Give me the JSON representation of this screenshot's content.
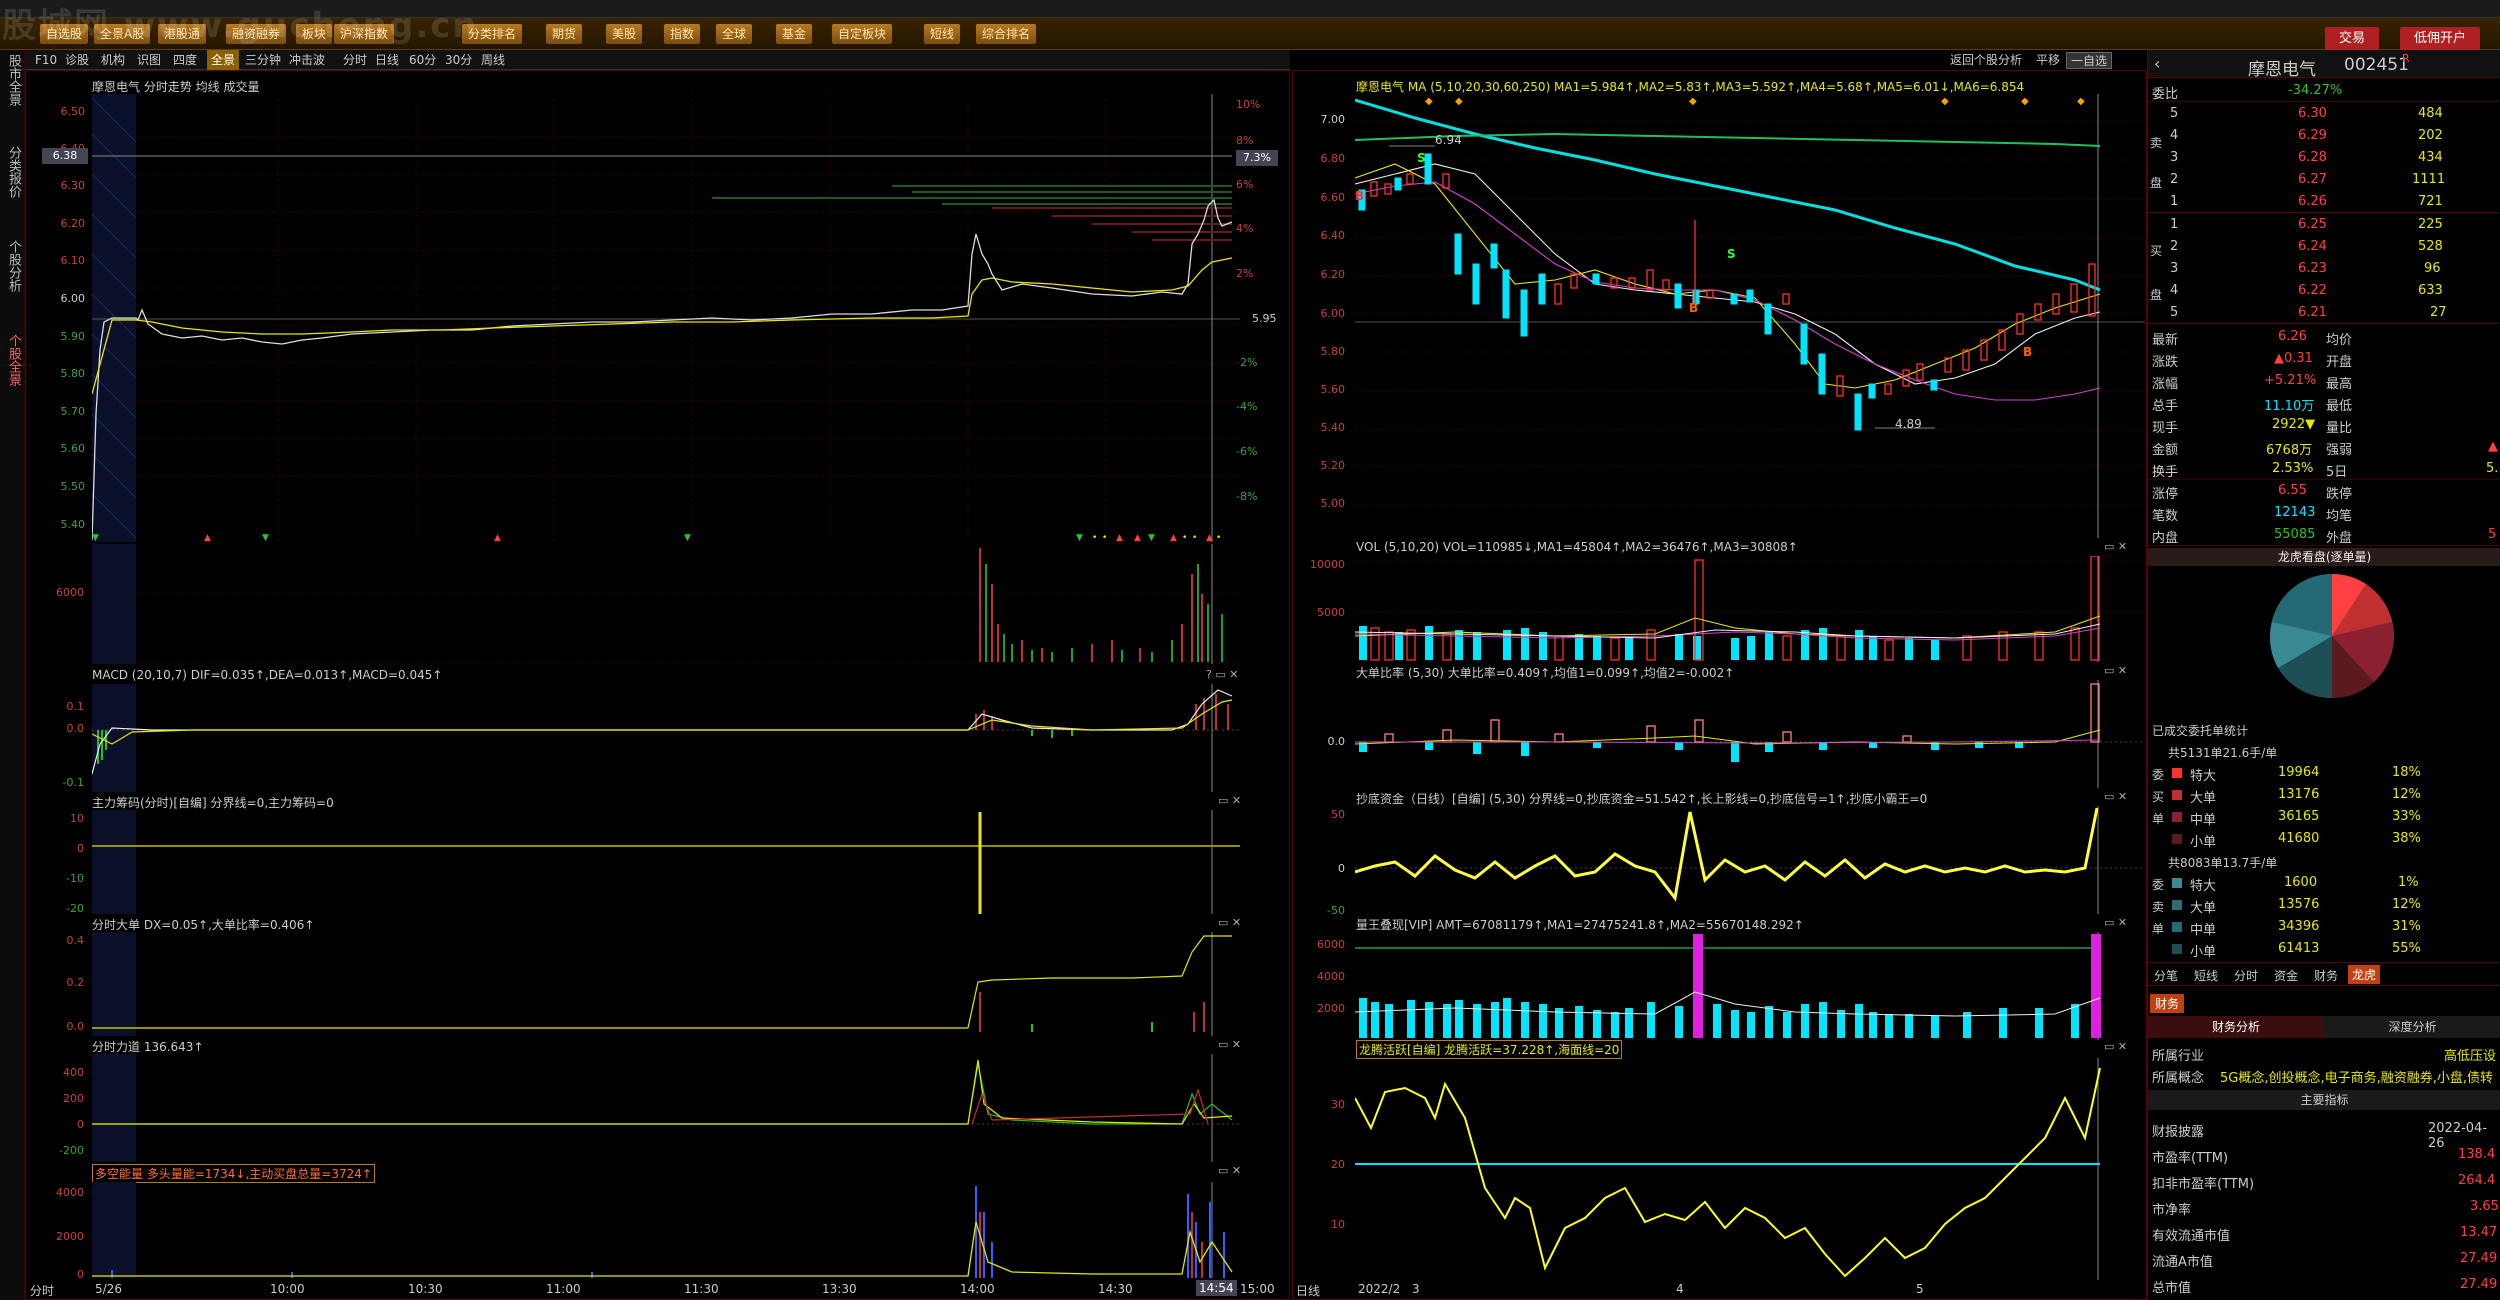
{
  "watermark": "股城网 www.gucheng.cn",
  "menu": [
    "自选股",
    "全景A股",
    "港股通",
    "融资融券",
    "板块",
    "沪深指数",
    "分类排名",
    "期货",
    "美股",
    "指数",
    "全球",
    "基金",
    "自定板块",
    "短线",
    "综合排名"
  ],
  "account_buttons": [
    "交易",
    "低佣开户"
  ],
  "left_tabs": [
    "股市全景",
    "分类报价",
    "个股分析",
    "个股全景"
  ],
  "intraday": {
    "toolbar": [
      "F10",
      "诊股",
      "机构",
      "识图",
      "四度",
      "全景",
      "三分钟",
      "冲击波",
      "分时",
      "日线",
      "60分",
      "30分",
      "周线"
    ],
    "title": "摩恩电气 分时走势 均线 成交量",
    "price_axis": [
      "6.50",
      "6.40",
      "6.30",
      "6.20",
      "6.10",
      "6.00",
      "5.90",
      "5.80",
      "5.70",
      "5.60",
      "5.50",
      "5.40"
    ],
    "pct_axis": [
      "10%",
      "8%",
      "7.3%",
      "6%",
      "4%",
      "2%",
      "5.95",
      "-2%",
      "-4%",
      "-6%",
      "-8%"
    ],
    "current_price_tag": "6.38",
    "vol_axis": "6000",
    "macd_title": "MACD (20,10,7) DIF=0.035↑,DEA=0.013↑,MACD=0.045↑",
    "macd_axis": [
      "0.1",
      "0.0",
      "-0.1"
    ],
    "main_title": "主力筹码(分时)[自编] 分界线=0,主力筹码=0",
    "main_axis": [
      "10",
      "0",
      "-10",
      "-20"
    ],
    "dadan_title": "分时大单 DX=0.05↑,大单比率=0.406↑",
    "dadan_axis": [
      "0.4",
      "0.2",
      "0.0"
    ],
    "lidao_title": "分时力道 136.643↑",
    "lidao_axis": [
      "400",
      "200",
      "0",
      "-200"
    ],
    "duokong_title": "多空能量 多头量能=1734↓,主动买盘总量=3724↑",
    "duokong_axis": [
      "4000",
      "2000",
      "0"
    ],
    "time_axis": [
      "分时",
      "5/26",
      "10:00",
      "10:30",
      "11:00",
      "11:30",
      "13:30",
      "14:00",
      "14:30",
      "14:54",
      "15:00"
    ]
  },
  "kline": {
    "title": "摩恩电气  MA (5,10,20,30,60,250) MA1=5.984↑,MA2=5.83↑,MA3=5.592↑,MA4=5.68↑,MA5=6.01↓,MA6=6.854",
    "back_btn": "返回个股分析",
    "flat": "平移",
    "select": "一自选",
    "price_axis": [
      "7.00",
      "6.80",
      "6.60",
      "6.40",
      "6.20",
      "6.00",
      "5.80",
      "5.60",
      "5.40",
      "5.20",
      "5.00"
    ],
    "high_label": "6.94",
    "low_label": "4.89",
    "vol_title": "VOL (5,10,20) VOL=110985↓,MA1=45804↑,MA2=36476↑,MA3=30808↑",
    "vol_axis": [
      "10000",
      "5000"
    ],
    "ratio_title": "大单比率 (5,30) 大单比率=0.409↑,均值1=0.099↑,均值2=-0.002↑",
    "ratio_axis": [
      "0.0"
    ],
    "chaodi_title": "抄底资金（日线）[自编] (5,30) 分界线=0,抄底资金=51.542↑,长上影线=0,抄底信号=1↑,抄底小霸王=0",
    "chaodi_axis": [
      "50",
      "0",
      "-50"
    ],
    "liang_title": "量王叠现[VIP] AMT=67081179↑,MA1=27475241.8↑,MA2=55670148.292↑",
    "liang_axis": [
      "6000",
      "4000",
      "2000"
    ],
    "longteng_title": "龙腾活跃[自编] 龙腾活跃=37.228↑,海面线=20",
    "longteng_axis": [
      "30",
      "20",
      "10"
    ],
    "date_axis": [
      "日线",
      "2022/2",
      "3",
      "4",
      "5"
    ]
  },
  "quote": {
    "name": "摩恩电气",
    "code": "002451",
    "flag": "R",
    "webi_label": "委比",
    "webi": "-34.27%",
    "sell": [
      [
        "5",
        "6.30",
        "484"
      ],
      [
        "4",
        "6.29",
        "202"
      ],
      [
        "3",
        "6.28",
        "434"
      ],
      [
        "2",
        "6.27",
        "1111"
      ],
      [
        "1",
        "6.26",
        "721"
      ]
    ],
    "buy": [
      [
        "1",
        "6.25",
        "225"
      ],
      [
        "2",
        "6.24",
        "528"
      ],
      [
        "3",
        "6.23",
        "96"
      ],
      [
        "4",
        "6.22",
        "633"
      ],
      [
        "5",
        "6.21",
        "27"
      ]
    ],
    "side_sell": [
      "卖",
      "盘"
    ],
    "side_buy": [
      "买",
      "盘"
    ],
    "stats": [
      [
        "最新",
        "6.26",
        "均价",
        ""
      ],
      [
        "涨跌",
        "▲0.31",
        "开盘",
        ""
      ],
      [
        "涨幅",
        "+5.21%",
        "最高",
        ""
      ],
      [
        "总手",
        "11.10万",
        "最低",
        ""
      ],
      [
        "现手",
        "2922▼",
        "量比",
        ""
      ],
      [
        "金额",
        "6768万",
        "强弱",
        "▲"
      ],
      [
        "换手",
        "2.53%",
        "5日",
        "5."
      ],
      [
        "涨停",
        "6.55",
        "跌停",
        ""
      ],
      [
        "笔数",
        "12143",
        "均笔",
        ""
      ],
      [
        "内盘",
        "55085",
        "外盘",
        "5"
      ]
    ],
    "lh_title": "龙虎看盘(逐单量)",
    "wtjb_title": "已成交委托单统计",
    "buy_hdr": "共5131单21.6手/单",
    "buy_rows": [
      [
        "特大",
        "19964",
        "18%"
      ],
      [
        "大单",
        "13176",
        "12%"
      ],
      [
        "中单",
        "36165",
        "33%"
      ],
      [
        "小单",
        "41680",
        "38%"
      ]
    ],
    "sell_hdr": "共8083单13.7手/单",
    "sell_rows": [
      [
        "特大",
        "1600",
        "1%"
      ],
      [
        "大单",
        "13576",
        "12%"
      ],
      [
        "中单",
        "34396",
        "31%"
      ],
      [
        "小单",
        "61413",
        "55%"
      ]
    ],
    "side_wei": [
      "委",
      "买",
      "单"
    ],
    "side_wei2": [
      "委",
      "卖",
      "单"
    ],
    "tabs": [
      "分笔",
      "短线",
      "分时",
      "资金",
      "财务",
      "龙虎"
    ],
    "fin_tab": "财务",
    "fin_subtabs": [
      "财务分析",
      "深度分析"
    ],
    "industry_label": "所属行业",
    "industry": "高低压设",
    "concept_label": "所属概念",
    "concept": "5G概念,创投概念,电子商务,融资融券,小盘,债转",
    "main_index": "主要指标",
    "fin_rows": [
      [
        "财报披露",
        "2022-04-26"
      ],
      [
        "市盈率(TTM)",
        "138.4"
      ],
      [
        "扣非市盈率(TTM)",
        "264.4"
      ],
      [
        "市净率",
        "3.65"
      ],
      [
        "有效流通市值",
        "13.47"
      ],
      [
        "流通A市值",
        "27.49"
      ],
      [
        "总市值",
        "27.49"
      ]
    ]
  },
  "colors": {
    "up": "#ff3030",
    "down": "#00e5ff",
    "ma_yellow": "#e8e800",
    "accent": "#b02020"
  }
}
